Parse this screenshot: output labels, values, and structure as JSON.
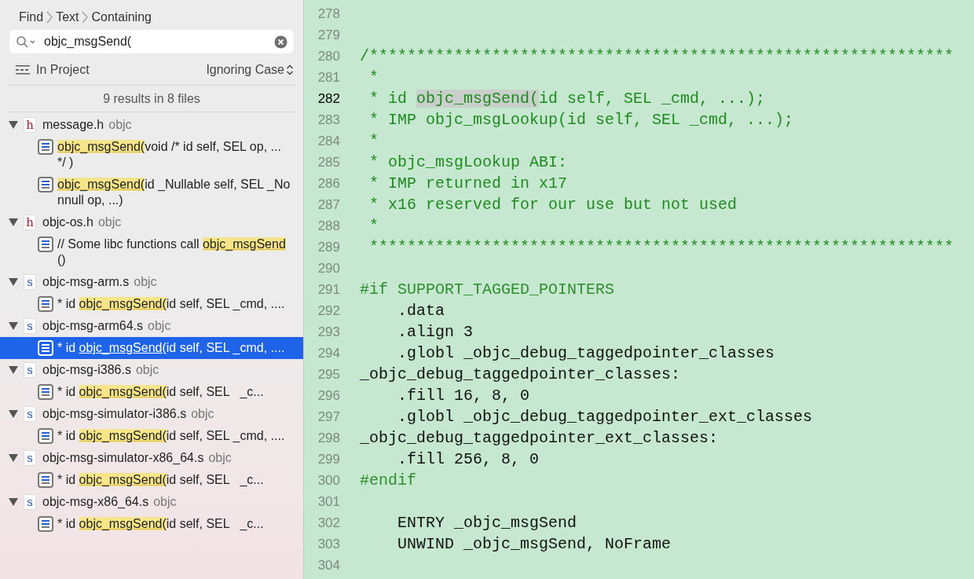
{
  "breadcrumb": [
    "Find",
    "Text",
    "Containing"
  ],
  "search": {
    "value": "objc_msgSend("
  },
  "scope": "In Project",
  "matching": "Ignoring Case",
  "summary": "9 results in 8 files",
  "files": [
    {
      "letter": "h",
      "kind": "header",
      "name": "message.h",
      "group": "objc",
      "expanded": true,
      "results": [
        {
          "match": "objc_msgSend(",
          "after": "void /* id self, SEL op, ... */ )",
          "selected": false
        },
        {
          "match": "objc_msgSend(",
          "after": "id _Nullable self, SEL _Nonnull op, ...)",
          "selected": false
        }
      ]
    },
    {
      "letter": "h",
      "kind": "header",
      "name": "objc-os.h",
      "group": "objc",
      "expanded": true,
      "results": [
        {
          "before": "// Some libc functions call ",
          "match": "objc_msgSend",
          "after": "()",
          "selected": false
        }
      ]
    },
    {
      "letter": "s",
      "kind": "assembly",
      "name": "objc-msg-arm.s",
      "group": "objc",
      "expanded": true,
      "results": [
        {
          "before": "* id ",
          "match": "objc_msgSend(",
          "after": "id self, SEL _cmd, ....",
          "selected": false
        }
      ]
    },
    {
      "letter": "s",
      "kind": "assembly",
      "name": "objc-msg-arm64.s",
      "group": "objc",
      "expanded": true,
      "results": [
        {
          "before": "* id ",
          "match": "objc_msgSend(",
          "after": "id self, SEL _cmd, ....",
          "selected": true
        }
      ]
    },
    {
      "letter": "s",
      "kind": "assembly",
      "name": "objc-msg-i386.s",
      "group": "objc",
      "expanded": true,
      "results": [
        {
          "before": "* id ",
          "match": "objc_msgSend(",
          "after": "id self, SEL   _c...",
          "selected": false
        }
      ]
    },
    {
      "letter": "s",
      "kind": "assembly",
      "name": "objc-msg-simulator-i386.s",
      "group": "objc",
      "expanded": true,
      "results": [
        {
          "before": "* id ",
          "match": "objc_msgSend(",
          "after": "id self, SEL _cmd, ....",
          "selected": false
        }
      ]
    },
    {
      "letter": "s",
      "kind": "assembly",
      "name": "objc-msg-simulator-x86_64.s",
      "group": "objc",
      "expanded": true,
      "results": [
        {
          "before": "* id ",
          "match": "objc_msgSend(",
          "after": "id self, SEL   _c...",
          "selected": false
        }
      ]
    },
    {
      "letter": "s",
      "kind": "assembly",
      "name": "objc-msg-x86_64.s",
      "group": "objc",
      "expanded": true,
      "results": [
        {
          "before": "* id ",
          "match": "objc_msgSend(",
          "after": "id self, SEL   _c...",
          "selected": false
        }
      ]
    }
  ],
  "code": [
    {
      "number": "278",
      "current": false
    },
    {
      "number": "279",
      "current": false
    },
    {
      "number": "280",
      "kind": "comment",
      "current": false,
      "text": "/**************************************************************"
    },
    {
      "number": "281",
      "kind": "comment",
      "current": false,
      "text": " *"
    },
    {
      "number": "282",
      "kind": "comment",
      "current": true,
      "text": " * id ",
      "match": "objc_msgSend(",
      "after": "id self, SEL _cmd, ...);"
    },
    {
      "number": "283",
      "kind": "comment",
      "current": false,
      "text": " * IMP objc_msgLookup(id self, SEL _cmd, ...);"
    },
    {
      "number": "284",
      "kind": "comment",
      "current": false,
      "text": " *"
    },
    {
      "number": "285",
      "kind": "comment",
      "current": false,
      "text": " * objc_msgLookup ABI:"
    },
    {
      "number": "286",
      "kind": "comment",
      "current": false,
      "text": " * IMP returned in x17"
    },
    {
      "number": "287",
      "kind": "comment",
      "current": false,
      "text": " * x16 reserved for our use but not used"
    },
    {
      "number": "288",
      "kind": "comment",
      "current": false,
      "text": " *"
    },
    {
      "number": "289",
      "kind": "comment",
      "current": false,
      "text": " **************************************************************"
    },
    {
      "number": "290",
      "current": false
    },
    {
      "number": "291",
      "kind": "preprocessor",
      "current": false,
      "text": "#if SUPPORT_TAGGED_POINTERS"
    },
    {
      "number": "292",
      "kind": "plain",
      "current": false,
      "text": "    .data"
    },
    {
      "number": "293",
      "kind": "plain",
      "current": false,
      "text": "    .align 3"
    },
    {
      "number": "294",
      "kind": "plain",
      "current": false,
      "text": "    .globl _objc_debug_taggedpointer_classes"
    },
    {
      "number": "295",
      "kind": "plain",
      "current": false,
      "text": "_objc_debug_taggedpointer_classes:"
    },
    {
      "number": "296",
      "kind": "plain",
      "current": false,
      "text": "    .fill 16, 8, 0"
    },
    {
      "number": "297",
      "kind": "plain",
      "current": false,
      "text": "    .globl _objc_debug_taggedpointer_ext_classes"
    },
    {
      "number": "298",
      "kind": "plain",
      "current": false,
      "text": "_objc_debug_taggedpointer_ext_classes:"
    },
    {
      "number": "299",
      "kind": "plain",
      "current": false,
      "text": "    .fill 256, 8, 0"
    },
    {
      "number": "300",
      "kind": "preprocessor",
      "current": false,
      "text": "#endif"
    },
    {
      "number": "301",
      "current": false
    },
    {
      "number": "302",
      "kind": "plain",
      "current": false,
      "text": "    ENTRY _objc_msgSend"
    },
    {
      "number": "303",
      "kind": "plain",
      "current": false,
      "text": "    UNWIND _objc_msgSend, NoFrame"
    },
    {
      "number": "304",
      "current": false
    }
  ]
}
